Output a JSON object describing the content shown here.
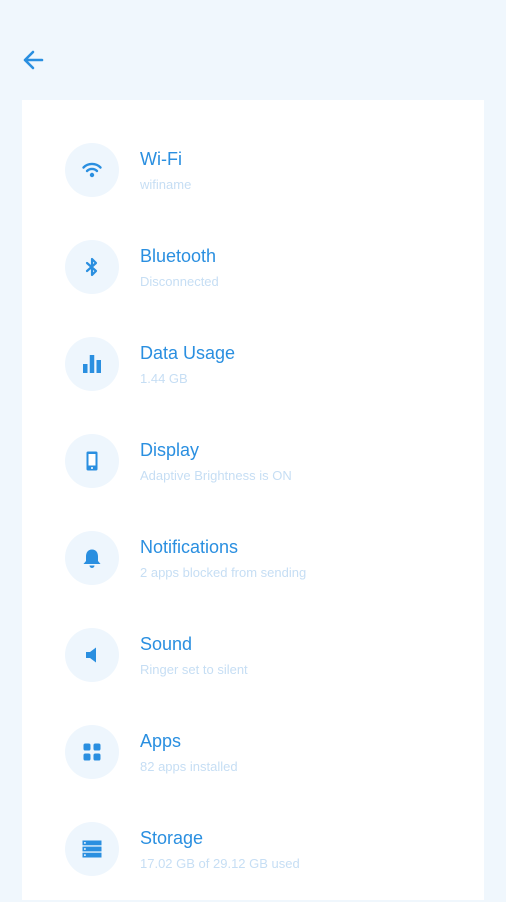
{
  "colors": {
    "page_bg": "#f0f7fd",
    "card_bg": "#ffffff",
    "accent": "#2a8fe0",
    "icon_circle_bg": "#eef6fd",
    "subtitle": "#c6def4"
  },
  "header": {
    "back_icon": "arrow-left-icon"
  },
  "settings": [
    {
      "title": "Wi-Fi",
      "subtitle": "wifiname",
      "icon": "wifi-icon"
    },
    {
      "title": "Bluetooth",
      "subtitle": "Disconnected",
      "icon": "bluetooth-icon"
    },
    {
      "title": "Data Usage",
      "subtitle": "1.44 GB",
      "icon": "bar-chart-icon"
    },
    {
      "title": "Display",
      "subtitle": "Adaptive Brightness is ON",
      "icon": "phone-icon"
    },
    {
      "title": "Notifications",
      "subtitle": "2 apps blocked from sending",
      "icon": "bell-icon"
    },
    {
      "title": "Sound",
      "subtitle": "Ringer set to silent",
      "icon": "speaker-icon"
    },
    {
      "title": "Apps",
      "subtitle": "82 apps installed",
      "icon": "grid-icon"
    },
    {
      "title": "Storage",
      "subtitle": "17.02 GB of 29.12 GB used",
      "icon": "storage-icon"
    }
  ]
}
